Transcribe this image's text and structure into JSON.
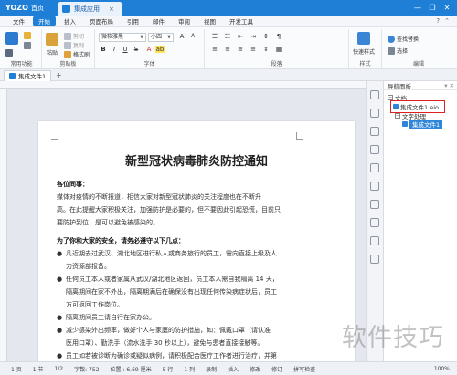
{
  "titlebar": {
    "app": "YOZO",
    "home_tab": "首页",
    "doc_tab": "集成应用",
    "close_tab": "×",
    "controls": [
      "—",
      "❐",
      "✕"
    ]
  },
  "menu": {
    "items": [
      "文件",
      "开始",
      "插入",
      "页面布局",
      "引用",
      "邮件",
      "审阅",
      "视图",
      "开发工具"
    ],
    "active_index": 1
  },
  "ribbon": {
    "groups": {
      "common": "常用功能",
      "clipboard": "剪贴板",
      "font": "字体",
      "paragraph": "段落",
      "style": "样式",
      "edit": "编辑"
    },
    "clipboard_btns": {
      "cut": "剪切",
      "copy": "复制",
      "paste": "粘贴",
      "format": "格式刷"
    },
    "font_name": "微软雅黑",
    "font_size": "小四",
    "quick_style": "快速样式",
    "find": "查找替换",
    "select": "选择"
  },
  "tabs": {
    "doc": "集成文件1"
  },
  "doc": {
    "title": "新型冠状病毒肺炎防控通知",
    "section1_heading": "各位同事：",
    "section1_body": [
      "    媒体对疫情的不断报道，相信大家对新型冠状肺炎的关注程度也在不断升",
      "高。在此提醒大家积极关注，加强防护是必要的，但不要因此引起恐慌，目前只",
      "要防护到位，是可以避免被感染的。"
    ],
    "section2_heading": "为了你和大家的安全，请务必遵守以下几点：",
    "bullets": [
      [
        "凡近期去过武汉、湖北地区进行私人或商务旅行的员工，需向直接上级及人",
        "力资源部报备。"
      ],
      [
        "任何员工本人或者家属从武汉/湖北地区返回，员工本人需自我隔离 14 天，",
        "隔离期间在家不外出，隔离期满后在确保没有出现任何传染病症状后，员工",
        "方可返回工作岗位。"
      ],
      [
        "隔离期间员工请自行在家办公。"
      ],
      [
        "减少感染外出频率，做好个人与家庭的防护措施，如：佩戴口罩（请认准",
        "医用口罩）、勤洗手（流水洗手 30 秒以上），避免与患者直接接触等。"
      ],
      [
        "员工如若被诊断为确诊或疑似病例，请积极配合医疗工作者进行治疗，并第"
      ]
    ],
    "bullet_symbol": "●"
  },
  "nav": {
    "header": "导航面板",
    "root": "文档",
    "selected": "集成文件1.eio",
    "child": "文字处理",
    "leaf": "集成文件1"
  },
  "status": {
    "page": "1 页",
    "pages": "1 节",
    "ratio": "1/2",
    "words": "字数: 752",
    "pos": "位置 : 6.69 厘米",
    "row": "5 行",
    "col": "1 列",
    "record": "录制",
    "insert": "插入",
    "modify": "修改",
    "track": "修订",
    "spell": "拼写检查",
    "zoom": "100%"
  },
  "watermark": "软件技巧",
  "colors": {
    "titlebar": "#1f7fd6",
    "active_menu": "#1f7fd6",
    "highlight": "#e02020"
  }
}
